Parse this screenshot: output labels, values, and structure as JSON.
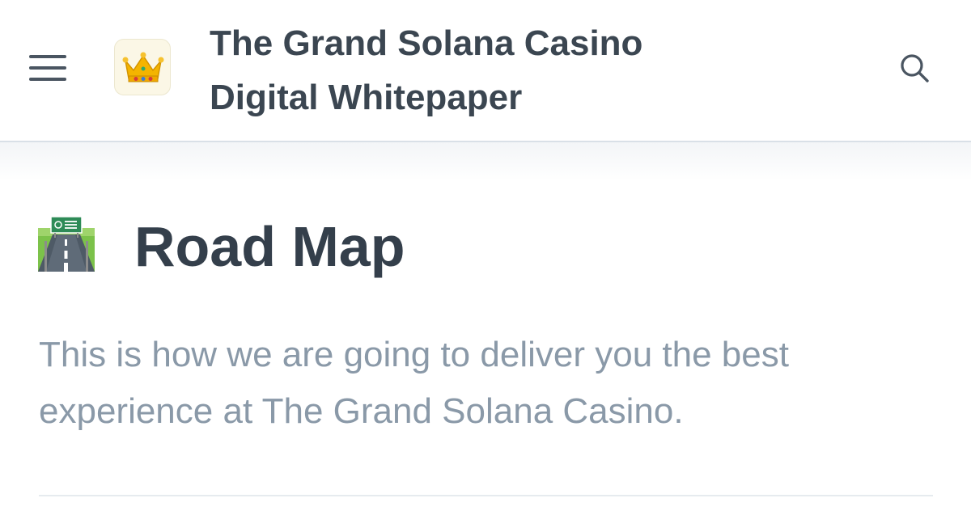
{
  "header": {
    "title_line1": "The Grand Solana Casino",
    "title_line2": "Digital Whitepaper",
    "menu_icon": "hamburger-menu-icon",
    "logo_icon": "crown-icon",
    "search_icon": "search-icon"
  },
  "page": {
    "icon": "motorway-icon",
    "title": "Road Map",
    "description": "This is how we are going to deliver you the best experience at The Grand Solana Casino."
  },
  "colors": {
    "heading": "#343f4b",
    "description": "#8a99a8",
    "border": "#d9e0e7"
  }
}
